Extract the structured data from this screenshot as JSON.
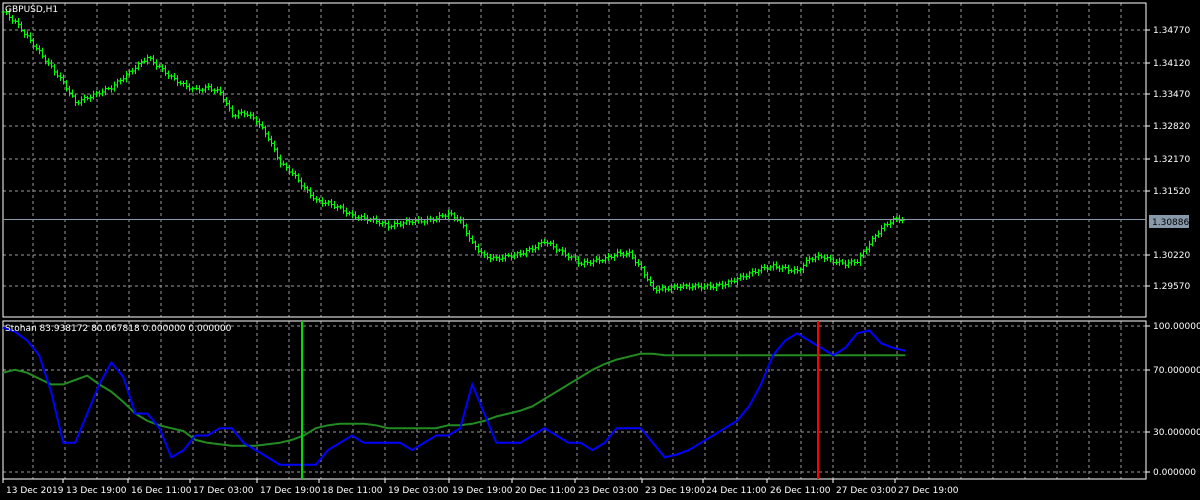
{
  "symbol": "GBPUSD,H1",
  "current_price": "1.30886",
  "colors": {
    "background": "#000000",
    "grid": "#9a9a9a",
    "candle": "#00ff00",
    "stoch_main": "#0000ff",
    "stoch_signal": "#228b22",
    "vline_buy": "#00dd00",
    "vline_sell": "#ff0000",
    "bid_line": "#8899aa"
  },
  "price_axis": [
    "1.34770",
    "1.34120",
    "1.33470",
    "1.32820",
    "1.32170",
    "1.31520",
    "1.30220",
    "1.29570"
  ],
  "stoch_axis": [
    "100.000000",
    "70.000000",
    "30.000000",
    "0.000000"
  ],
  "time_axis": [
    "13 Dec 2019",
    "13 Dec 19:00",
    "16 Dec 11:00",
    "17 Dec 03:00",
    "17 Dec 19:00",
    "18 Dec 11:00",
    "19 Dec 03:00",
    "19 Dec 19:00",
    "20 Dec 11:00",
    "23 Dec 03:00",
    "23 Dec 19:00",
    "24 Dec 11:00",
    "26 Dec 11:00",
    "27 Dec 03:00",
    "27 Dec 19:00"
  ],
  "indicator_label": "Stohan 83.938172 80.067818 0.000000 0.000000",
  "chart_data": [
    {
      "type": "line",
      "series": [
        {
          "values": [
            [
              0,
              1.35
            ],
            [
              4,
              1.348
            ],
            [
              8,
              1.345
            ],
            [
              12,
              1.342
            ],
            [
              16,
              1.339
            ],
            [
              20,
              1.336
            ],
            [
              24,
              1.332
            ],
            [
              28,
              1.333
            ],
            [
              32,
              1.334
            ],
            [
              36,
              1.335
            ],
            [
              40,
              1.337
            ],
            [
              44,
              1.339
            ],
            [
              48,
              1.341
            ],
            [
              52,
              1.339
            ],
            [
              56,
              1.337
            ],
            [
              60,
              1.3355
            ],
            [
              64,
              1.3345
            ],
            [
              68,
              1.335
            ],
            [
              72,
              1.334
            ],
            [
              76,
              1.3295
            ],
            [
              80,
              1.33
            ],
            [
              84,
              1.3285
            ],
            [
              88,
              1.325
            ],
            [
              92,
              1.32
            ],
            [
              96,
              1.318
            ],
            [
              100,
              1.315
            ],
            [
              104,
              1.3125
            ],
            [
              108,
              1.312
            ],
            [
              112,
              1.311
            ],
            [
              116,
              1.3095
            ],
            [
              120,
              1.309
            ],
            [
              124,
              1.3085
            ],
            [
              128,
              1.3075
            ],
            [
              132,
              1.308
            ],
            [
              136,
              1.3085
            ],
            [
              140,
              1.3085
            ],
            [
              144,
              1.309
            ],
            [
              148,
              1.31
            ],
            [
              152,
              1.3085
            ],
            [
              156,
              1.304
            ],
            [
              160,
              1.3015
            ],
            [
              164,
              1.301
            ],
            [
              168,
              1.3015
            ],
            [
              172,
              1.302
            ],
            [
              176,
              1.303
            ],
            [
              180,
              1.3045
            ],
            [
              184,
              1.303
            ],
            [
              188,
              1.3015
            ],
            [
              192,
              1.3
            ],
            [
              196,
              1.3005
            ],
            [
              200,
              1.301
            ],
            [
              204,
              1.302
            ],
            [
              208,
              1.302
            ],
            [
              212,
              1.299
            ],
            [
              216,
              1.295
            ],
            [
              220,
              1.295
            ],
            [
              224,
              1.2955
            ],
            [
              228,
              1.2955
            ],
            [
              232,
              1.2955
            ],
            [
              236,
              1.2955
            ],
            [
              240,
              1.296
            ],
            [
              244,
              1.297
            ],
            [
              248,
              1.298
            ],
            [
              252,
              1.299
            ],
            [
              256,
              1.2995
            ],
            [
              260,
              1.299
            ],
            [
              264,
              1.2985
            ],
            [
              268,
              1.301
            ],
            [
              272,
              1.3015
            ],
            [
              276,
              1.3005
            ],
            [
              280,
              1.3
            ],
            [
              284,
              1.3005
            ],
            [
              288,
              1.304
            ],
            [
              292,
              1.307
            ],
            [
              296,
              1.3088
            ],
            [
              300,
              1.3088
            ]
          ]
        }
      ],
      "x_range": [
        0,
        380
      ],
      "ylim": [
        1.293,
        1.35
      ]
    },
    {
      "type": "line",
      "series": [
        {
          "values": [
            [
              0,
              99
            ],
            [
              4,
              96
            ],
            [
              8,
              90
            ],
            [
              12,
              80
            ],
            [
              16,
              55
            ],
            [
              20,
              20
            ],
            [
              24,
              20
            ],
            [
              28,
              40
            ],
            [
              32,
              60
            ],
            [
              36,
              75
            ],
            [
              40,
              65
            ],
            [
              44,
              40
            ],
            [
              48,
              40
            ],
            [
              52,
              30
            ],
            [
              56,
              10
            ],
            [
              60,
              15
            ],
            [
              64,
              25
            ],
            [
              68,
              25
            ],
            [
              72,
              30
            ],
            [
              76,
              30
            ],
            [
              80,
              20
            ],
            [
              84,
              15
            ],
            [
              88,
              10
            ],
            [
              92,
              5
            ],
            [
              96,
              5
            ],
            [
              100,
              5
            ],
            [
              104,
              5
            ],
            [
              108,
              15
            ],
            [
              112,
              20
            ],
            [
              116,
              25
            ],
            [
              120,
              20
            ],
            [
              124,
              20
            ],
            [
              128,
              20
            ],
            [
              132,
              20
            ],
            [
              136,
              15
            ],
            [
              140,
              20
            ],
            [
              144,
              25
            ],
            [
              148,
              25
            ],
            [
              152,
              30
            ],
            [
              156,
              60
            ],
            [
              160,
              40
            ],
            [
              164,
              20
            ],
            [
              168,
              20
            ],
            [
              172,
              20
            ],
            [
              176,
              25
            ],
            [
              180,
              30
            ],
            [
              184,
              25
            ],
            [
              188,
              20
            ],
            [
              192,
              20
            ],
            [
              196,
              15
            ],
            [
              200,
              20
            ],
            [
              204,
              30
            ],
            [
              208,
              30
            ],
            [
              212,
              30
            ],
            [
              216,
              20
            ],
            [
              220,
              10
            ],
            [
              224,
              12
            ],
            [
              228,
              15
            ],
            [
              232,
              20
            ],
            [
              236,
              25
            ],
            [
              240,
              30
            ],
            [
              244,
              35
            ],
            [
              248,
              45
            ],
            [
              252,
              60
            ],
            [
              256,
              80
            ],
            [
              260,
              90
            ],
            [
              264,
              95
            ],
            [
              268,
              90
            ],
            [
              272,
              85
            ],
            [
              276,
              80
            ],
            [
              280,
              85
            ],
            [
              284,
              95
            ],
            [
              288,
              97
            ],
            [
              292,
              88
            ],
            [
              296,
              85
            ],
            [
              300,
              83
            ]
          ]
        },
        {
          "values": [
            [
              0,
              68
            ],
            [
              4,
              70
            ],
            [
              8,
              68
            ],
            [
              12,
              64
            ],
            [
              16,
              60
            ],
            [
              20,
              60
            ],
            [
              24,
              63
            ],
            [
              28,
              66
            ],
            [
              32,
              60
            ],
            [
              36,
              55
            ],
            [
              40,
              48
            ],
            [
              44,
              40
            ],
            [
              48,
              35
            ],
            [
              52,
              32
            ],
            [
              56,
              30
            ],
            [
              60,
              28
            ],
            [
              64,
              22
            ],
            [
              68,
              20
            ],
            [
              72,
              19
            ],
            [
              76,
              18
            ],
            [
              80,
              18
            ],
            [
              84,
              18
            ],
            [
              88,
              19
            ],
            [
              92,
              20
            ],
            [
              96,
              22
            ],
            [
              100,
              25
            ],
            [
              104,
              30
            ],
            [
              108,
              32
            ],
            [
              112,
              33
            ],
            [
              116,
              33
            ],
            [
              120,
              33
            ],
            [
              124,
              32
            ],
            [
              128,
              30
            ],
            [
              132,
              30
            ],
            [
              136,
              30
            ],
            [
              140,
              30
            ],
            [
              144,
              30
            ],
            [
              148,
              32
            ],
            [
              152,
              32
            ],
            [
              156,
              33
            ],
            [
              160,
              35
            ],
            [
              164,
              38
            ],
            [
              168,
              40
            ],
            [
              172,
              42
            ],
            [
              176,
              45
            ],
            [
              180,
              50
            ],
            [
              184,
              55
            ],
            [
              188,
              60
            ],
            [
              192,
              65
            ],
            [
              196,
              70
            ],
            [
              200,
              74
            ],
            [
              204,
              77
            ],
            [
              208,
              79
            ],
            [
              212,
              81
            ],
            [
              216,
              81
            ],
            [
              220,
              80
            ],
            [
              224,
              80
            ],
            [
              228,
              80
            ],
            [
              232,
              80
            ],
            [
              236,
              80
            ],
            [
              240,
              80
            ],
            [
              244,
              80
            ],
            [
              248,
              80
            ],
            [
              252,
              80
            ],
            [
              256,
              80
            ],
            [
              260,
              80
            ],
            [
              264,
              80
            ],
            [
              268,
              80
            ],
            [
              272,
              80
            ],
            [
              276,
              80
            ],
            [
              280,
              80
            ],
            [
              284,
              80
            ],
            [
              288,
              80
            ],
            [
              292,
              80
            ],
            [
              296,
              80
            ],
            [
              300,
              80
            ]
          ]
        }
      ],
      "x_range": [
        0,
        380
      ],
      "ylim": [
        0,
        100
      ]
    }
  ]
}
